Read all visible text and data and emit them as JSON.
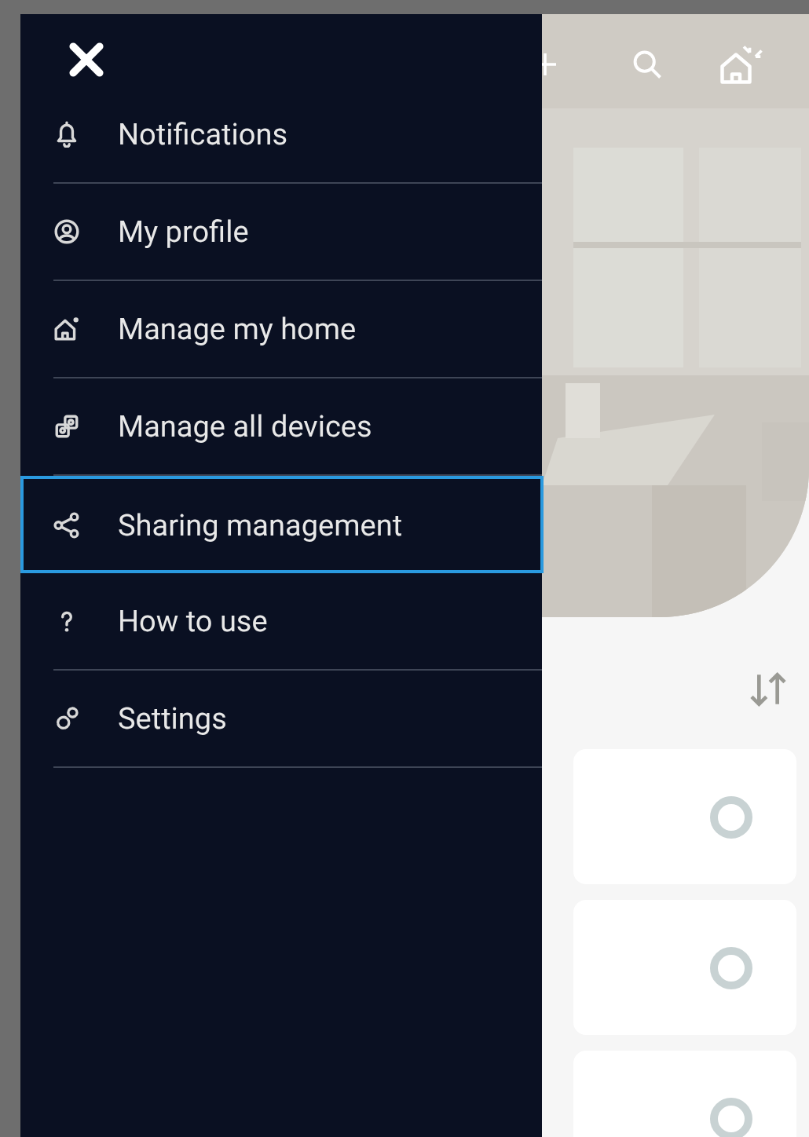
{
  "drawer": {
    "items": [
      {
        "label": "Notifications",
        "selected": false
      },
      {
        "label": "My profile",
        "selected": false
      },
      {
        "label": "Manage my home",
        "selected": false
      },
      {
        "label": "Manage all devices",
        "selected": false
      },
      {
        "label": "Sharing management",
        "selected": true
      },
      {
        "label": "How to use",
        "selected": false
      },
      {
        "label": "Settings",
        "selected": false
      }
    ]
  },
  "device_cards": [
    {
      "kind": "device"
    },
    {
      "kind": "device"
    },
    {
      "kind": "device"
    }
  ]
}
